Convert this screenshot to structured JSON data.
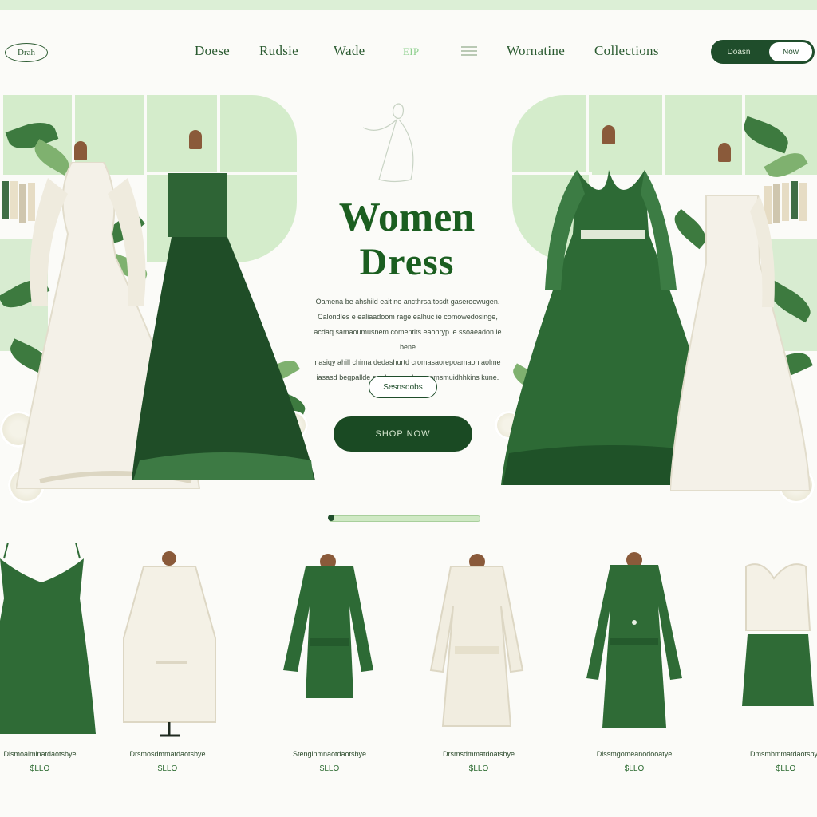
{
  "nav": {
    "logo": "Drah",
    "links": [
      "Doese",
      "Rudsie",
      "Wade",
      "EIP",
      "Wornatine",
      "Collections"
    ],
    "toggle_left": "Doasn",
    "toggle_right": "Now"
  },
  "hero": {
    "title_line1": "Women",
    "title_line2": "Dress",
    "description": [
      "Oamena be ahshild eait ne ancthrsa tosdt gaseroowugen.",
      "Calondles e ealiaadoom rage ealhuc ie comowedosinge,",
      "acdaq samaoumusnem comentits eaohryp ie ssoaeadon le bene",
      "nasiqy ahill chima dedashurtd cromasaorepoamaon aolme",
      "iasasd begpallde amdse asu darg comsmuidhhkins kune."
    ],
    "secondary_button": "Sesnsdobs",
    "shop_button": "SHOP NOW"
  },
  "products": [
    {
      "name": "Dismoalminatdaotsbye",
      "price": "$LLO",
      "color": "#2f6b36"
    },
    {
      "name": "Drsmosdmmatdaotsbye",
      "price": "$LLO",
      "color": "#f4f1e6"
    },
    {
      "name": "Stenginmnaotdaotsbye",
      "price": "$LLO",
      "color": "#2d6a35"
    },
    {
      "name": "Drsmsdmmatdoatsbye",
      "price": "$LLO",
      "color": "#f1ede0"
    },
    {
      "name": "Dissmgomeanodooatye",
      "price": "$LLO",
      "color": "#2f6b36"
    },
    {
      "name": "Dmsmbmmatdaotsbye",
      "price": "$LLO",
      "color": "#2f6b36"
    }
  ]
}
